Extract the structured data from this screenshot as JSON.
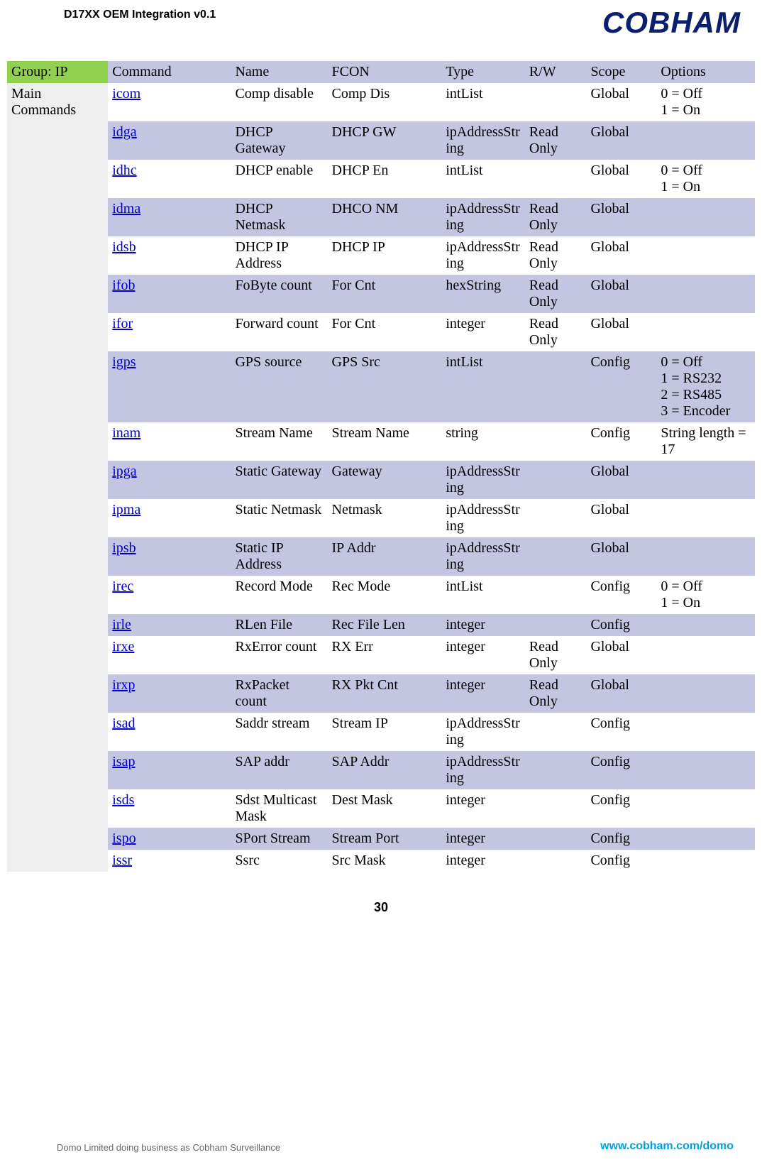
{
  "header": {
    "doc_title": "D17XX OEM Integration v0.1",
    "logo_text": "COBHAM"
  },
  "table": {
    "group_header": "Group: IP",
    "columns": [
      "Command",
      "Name",
      "FCON",
      "Type",
      "R/W",
      "Scope",
      "Options"
    ],
    "section_label": "Main Commands",
    "rows": [
      {
        "cmd": "icom",
        "name": "Comp disable",
        "fcon": "Comp Dis",
        "type": "intList",
        "rw": "",
        "scope": "Global",
        "options": "0 = Off\n1 = On",
        "alt": false
      },
      {
        "cmd": "idga",
        "name": "DHCP Gateway",
        "fcon": "DHCP GW",
        "type": "ipAddressString",
        "rw": "Read Only",
        "scope": "Global",
        "options": "",
        "alt": true
      },
      {
        "cmd": "idhc",
        "name": "DHCP enable",
        "fcon": "DHCP En",
        "type": "intList",
        "rw": "",
        "scope": "Global",
        "options": "0 = Off\n1 = On",
        "alt": false
      },
      {
        "cmd": "idma",
        "name": "DHCP Netmask",
        "fcon": "DHCO NM",
        "type": "ipAddressString",
        "rw": "Read Only",
        "scope": "Global",
        "options": "",
        "alt": true
      },
      {
        "cmd": "idsb",
        "name": "DHCP IP Address",
        "fcon": "DHCP IP",
        "type": "ipAddressString",
        "rw": "Read Only",
        "scope": "Global",
        "options": "",
        "alt": false
      },
      {
        "cmd": "ifob",
        "name": "FoByte count",
        "fcon": "For Cnt",
        "type": "hexString",
        "rw": "Read Only",
        "scope": "Global",
        "options": "",
        "alt": true
      },
      {
        "cmd": "ifor",
        "name": "Forward count",
        "fcon": "For Cnt",
        "type": "integer",
        "rw": "Read Only",
        "scope": "Global",
        "options": "",
        "alt": false
      },
      {
        "cmd": "igps",
        "name": "GPS source",
        "fcon": "GPS Src",
        "type": "intList",
        "rw": "",
        "scope": "Config",
        "options": "0 = Off\n1 = RS232\n2 = RS485\n3 = Encoder",
        "alt": true
      },
      {
        "cmd": "inam",
        "name": "Stream Name",
        "fcon": "Stream Name",
        "type": "string",
        "rw": "",
        "scope": "Config",
        "options": "String length = 17",
        "alt": false
      },
      {
        "cmd": "ipga",
        "name": "Static Gateway",
        "fcon": "Gateway",
        "type": "ipAddressString",
        "rw": "",
        "scope": "Global",
        "options": "",
        "alt": true
      },
      {
        "cmd": "ipma",
        "name": "Static Netmask",
        "fcon": "Netmask",
        "type": "ipAddressString",
        "rw": "",
        "scope": "Global",
        "options": "",
        "alt": false
      },
      {
        "cmd": "ipsb",
        "name": "Static IP Address",
        "fcon": "IP Addr",
        "type": "ipAddressString",
        "rw": "",
        "scope": "Global",
        "options": "",
        "alt": true
      },
      {
        "cmd": "irec",
        "name": "Record Mode",
        "fcon": "Rec Mode",
        "type": "intList",
        "rw": "",
        "scope": "Config",
        "options": "0 = Off\n1 = On",
        "alt": false
      },
      {
        "cmd": "irle",
        "name": "RLen File",
        "fcon": "Rec File Len",
        "type": "integer",
        "rw": "",
        "scope": "Config",
        "options": "",
        "alt": true
      },
      {
        "cmd": "irxe",
        "name": "RxError count",
        "fcon": "RX Err",
        "type": "integer",
        "rw": "Read Only",
        "scope": "Global",
        "options": "",
        "alt": false
      },
      {
        "cmd": "irxp",
        "name": "RxPacket count",
        "fcon": "RX Pkt Cnt",
        "type": "integer",
        "rw": "Read Only",
        "scope": "Global",
        "options": "",
        "alt": true
      },
      {
        "cmd": "isad",
        "name": "Saddr stream",
        "fcon": "Stream IP",
        "type": "ipAddressString",
        "rw": "",
        "scope": "Config",
        "options": "",
        "alt": false
      },
      {
        "cmd": "isap",
        "name": "SAP addr",
        "fcon": "SAP Addr",
        "type": "ipAddressString",
        "rw": "",
        "scope": "Config",
        "options": "",
        "alt": true
      },
      {
        "cmd": "isds",
        "name": "Sdst Multicast Mask",
        "fcon": "Dest Mask",
        "type": "integer",
        "rw": "",
        "scope": "Config",
        "options": "",
        "alt": false
      },
      {
        "cmd": "ispo",
        "name": "SPort Stream",
        "fcon": "Stream Port",
        "type": "integer",
        "rw": "",
        "scope": "Config",
        "options": "",
        "alt": true
      },
      {
        "cmd": "issr",
        "name": "Ssrc",
        "fcon": "Src Mask",
        "type": "integer",
        "rw": "",
        "scope": "Config",
        "options": "",
        "alt": false
      }
    ]
  },
  "footer": {
    "page_number": "30",
    "left": "Domo Limited doing business as Cobham Surveillance",
    "right": "www.cobham.com/domo"
  }
}
